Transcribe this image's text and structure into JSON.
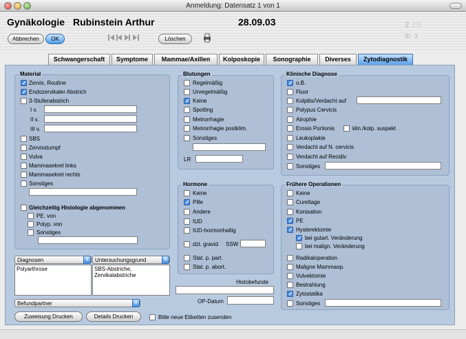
{
  "window": {
    "title": "Anmeldung: Datensatz 1 von 1"
  },
  "header": {
    "department": "Gynäkologie",
    "patient": "Rubinstein Arthur",
    "date": "28.09.03",
    "record_current": "2",
    "record_total": "20",
    "id_label": "ID",
    "id_value": "3",
    "cancel_label": "Abbrechen",
    "ok_label": "OK",
    "delete_label": "Löschen"
  },
  "tabs": [
    "Schwangerschaft",
    "Symptome",
    "Mammae/Axillen",
    "Kolposkopie",
    "Sonographie",
    "Diverses",
    "Zytodiagnostik"
  ],
  "active_tab": "Zytodiagnostik",
  "material": {
    "title": "Material",
    "items": [
      {
        "label": "Zervix, Routine",
        "checked": true
      },
      {
        "label": "Endozervikaler Abstrich",
        "checked": true
      },
      {
        "label": "3-Stufenabstrich",
        "checked": false
      }
    ],
    "stufen": [
      "I  v.",
      "II  v.",
      "III  v."
    ],
    "items2": [
      {
        "label": "SBS",
        "checked": false
      },
      {
        "label": "Zervixstumpf",
        "checked": false
      },
      {
        "label": "Vulva",
        "checked": false
      },
      {
        "label": "Mammasekret links",
        "checked": false
      },
      {
        "label": "Mammasekret rechts",
        "checked": false
      },
      {
        "label": "Sonstiges",
        "checked": false
      }
    ],
    "histo_label": "Gleichzeitig Histologie abgenommen",
    "histo_items": [
      "PE. von",
      "Polyp. von",
      "Sonstiges"
    ]
  },
  "blutungen": {
    "title": "Blutungen",
    "items": [
      {
        "label": "Regelmäßig",
        "checked": false
      },
      {
        "label": "Unregelmäßig",
        "checked": false
      },
      {
        "label": "Keine",
        "checked": true
      },
      {
        "label": "Spotting",
        "checked": false
      },
      {
        "label": "Metrorrhagie",
        "checked": false
      },
      {
        "label": "Metrorrhagie postklim.",
        "checked": false
      },
      {
        "label": "Sonstiges",
        "checked": false
      }
    ],
    "lr_label": "LR"
  },
  "hormone": {
    "title": "Hormone",
    "items": [
      {
        "label": "Keine",
        "checked": false
      },
      {
        "label": "Pille",
        "checked": true
      },
      {
        "label": "Andere",
        "checked": false
      },
      {
        "label": "IUD",
        "checked": false
      },
      {
        "label": "IUD-hormonhaltig",
        "checked": false
      }
    ],
    "gravid_label": "dzt. gravid",
    "ssw_label": "SSW",
    "items2": [
      {
        "label": "Stat. p. part.",
        "checked": false
      },
      {
        "label": "Stat. p. abort.",
        "checked": false
      }
    ]
  },
  "klinische": {
    "title": "Klinische Diagnose",
    "items": [
      {
        "label": "o.B.",
        "checked": true
      },
      {
        "label": "Fluor",
        "checked": false
      },
      {
        "label": "Kolpitis/Verdacht auf",
        "checked": false
      },
      {
        "label": "Polypus Cervicis",
        "checked": false
      },
      {
        "label": "Atrophie",
        "checked": false
      },
      {
        "label": "Erosio Portionis",
        "checked": false
      },
      {
        "label": "Leukoplakie",
        "checked": false
      },
      {
        "label": "Verdacht auf N. cervicis",
        "checked": false
      },
      {
        "label": "Verdacht auf Recidiv",
        "checked": false
      },
      {
        "label": "Sonstiges",
        "checked": false
      }
    ],
    "kolp_label": "klin./kolp. suspekt"
  },
  "operationen": {
    "title": "Frühere Operationen",
    "items": [
      {
        "label": "Keine",
        "checked": false
      },
      {
        "label": "Curettage",
        "checked": false
      },
      {
        "label": "Konisation",
        "checked": false
      },
      {
        "label": "PE",
        "checked": true
      },
      {
        "label": "Hysterektomie",
        "checked": true
      }
    ],
    "sub": [
      {
        "label": "bei gutart. Veränderung",
        "checked": true
      },
      {
        "label": "bei malign. Veränderung",
        "checked": false
      }
    ],
    "items2": [
      {
        "label": "Radikaloperation",
        "checked": false
      },
      {
        "label": "Maligne Mammaop.",
        "checked": false
      },
      {
        "label": "Vulvektomie",
        "checked": false
      },
      {
        "label": "Bestrahlung",
        "checked": false
      },
      {
        "label": "Zytostatika",
        "checked": true
      },
      {
        "label": "Sonstiges",
        "checked": false
      }
    ]
  },
  "lower": {
    "diagnosen_label": "Diagnosen",
    "diagnosen_text": "Polyarthrose",
    "untersuchung_label": "Untersuchungsgrund",
    "untersuchung_text": "SBS-Abstriche,\nZervikalabstriche",
    "histobefunde_label": "Histobefunde",
    "opdatum_label": "OP-Datum",
    "befundpartner_label": "Befundpartner",
    "zuweisung_label": "Zuweisung Drucken",
    "details_label": "Details Drucken",
    "etiketten_label": "Bitte neue Etiketten zusenden"
  }
}
